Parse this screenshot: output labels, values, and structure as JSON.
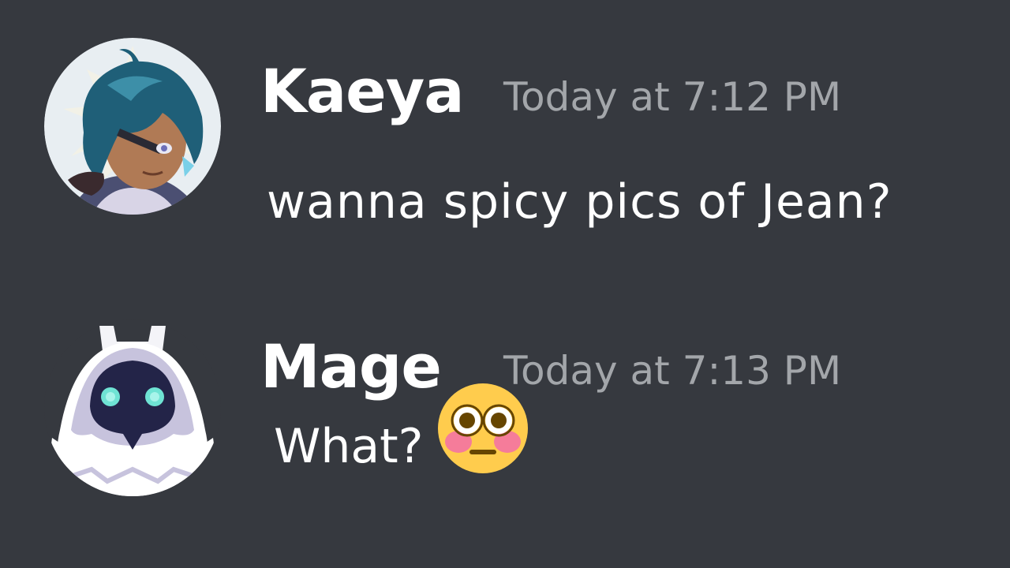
{
  "messages": [
    {
      "username": "Kaeya",
      "timestamp": "Today at 7:12 PM",
      "text": "wanna spicy pics of Jean?",
      "avatar_icon": "kaeya-avatar-icon"
    },
    {
      "username": "Mage",
      "timestamp": "Today at 7:13 PM",
      "text": "What?",
      "emoji": "flushed-face-icon",
      "avatar_icon": "abyss-mage-avatar-icon"
    }
  ],
  "colors": {
    "background": "#36393f",
    "username": "#ffffff",
    "timestamp": "#a3a6aa",
    "message_text": "#ffffff"
  }
}
